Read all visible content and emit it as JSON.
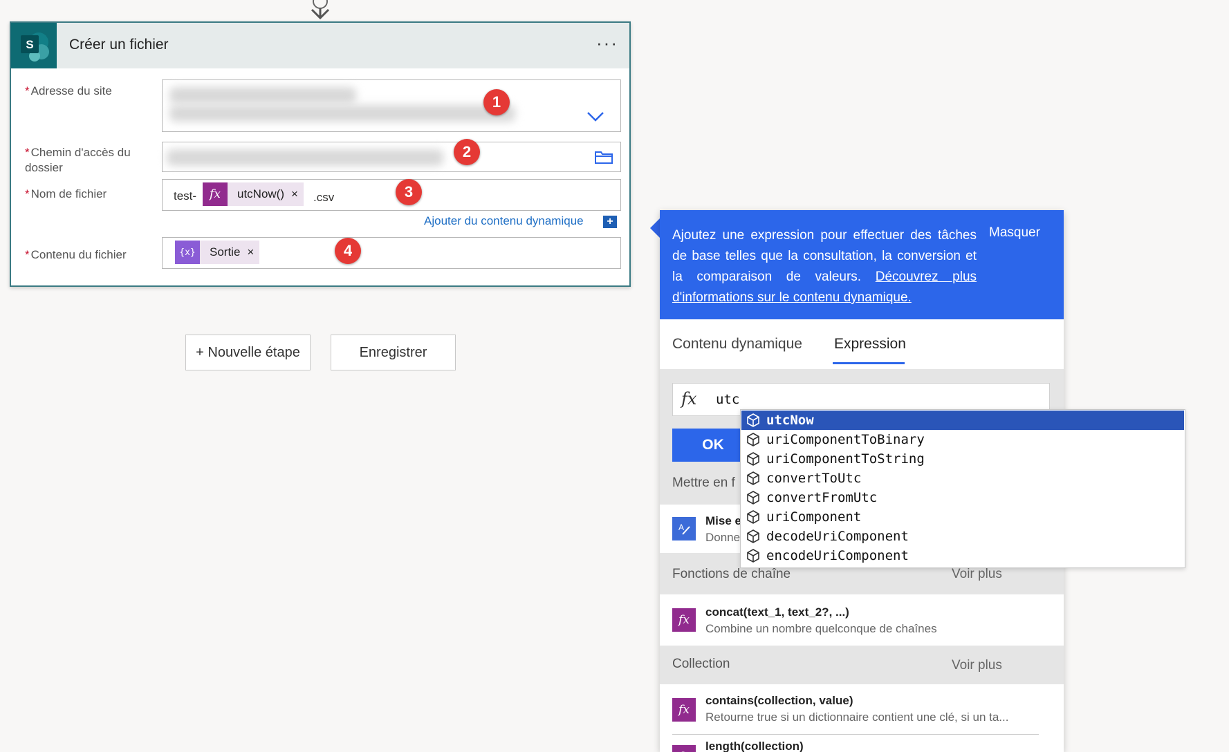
{
  "card": {
    "title": "Créer un fichier",
    "more_label": "···",
    "site_label": "Adresse du site",
    "folder_label": "Chemin d'accès du dossier",
    "filename_label": "Nom de fichier",
    "content_label": "Contenu du fichier",
    "required_mark": "*",
    "filename_prefix": "test-",
    "filename_token": "utcNow()",
    "filename_suffix": ".csv",
    "content_token": "Sortie",
    "token_remove": "×",
    "dynamic_link": "Ajouter du contenu dynamique",
    "plus": "+"
  },
  "badges": [
    "1",
    "2",
    "3",
    "4"
  ],
  "buttons": {
    "new_step": "+ Nouvelle étape",
    "save": "Enregistrer"
  },
  "panel": {
    "info_text": "Ajoutez une expression pour effectuer des tâches de base telles que la consultation, la conversion et la comparaison de valeurs. ",
    "info_link": "Découvrez plus d'informations sur le contenu dynamique.",
    "hide": "Masquer",
    "tab_dynamic": "Contenu dynamique",
    "tab_expression": "Expression",
    "expression_value": "utc",
    "ok": "OK",
    "partial_section": "Mettre en f",
    "partial_item_name": "Mise e",
    "partial_item_desc": "Donne",
    "section_string": "Fonctions de chaîne",
    "section_collection": "Collection",
    "see_more": "Voir plus",
    "items": [
      {
        "name": "concat(text_1, text_2?, ...)",
        "desc": "Combine un nombre quelconque de chaînes"
      },
      {
        "name": "contains(collection, value)",
        "desc": "Retourne true si un dictionnaire contient une clé, si un ta..."
      },
      {
        "name": "length(collection)",
        "desc": ""
      }
    ]
  },
  "suggestions": [
    "utcNow",
    "uriComponentToBinary",
    "uriComponentToString",
    "convertToUtc",
    "convertFromUtc",
    "uriComponent",
    "decodeUriComponent",
    "encodeUriComponent"
  ],
  "colors": {
    "accent": "#2c66ea",
    "card_border": "#3a7a83",
    "sharepoint": "#0e6b73",
    "token_bg": "#ede3ef",
    "function_icon": "#912b8e",
    "badge": "#e53935",
    "suggestion_selected": "#2a55b8"
  }
}
